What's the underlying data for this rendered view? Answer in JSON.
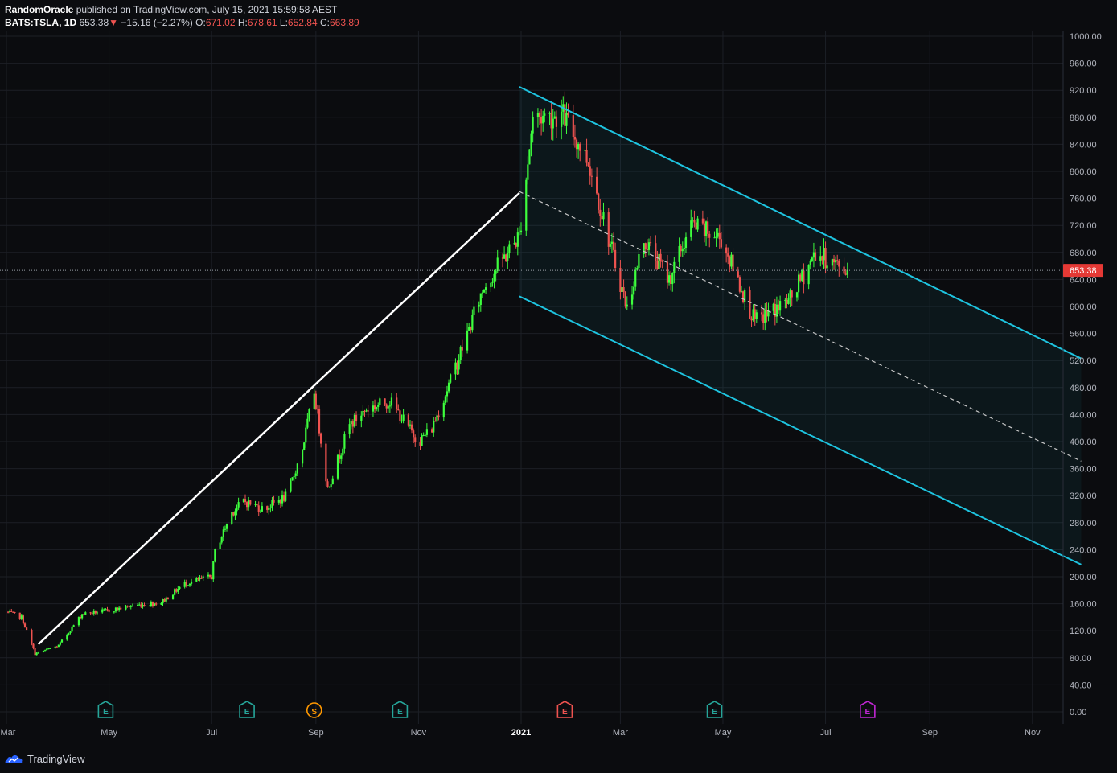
{
  "header": {
    "author": "RandomOracle",
    "published_text": "published on TradingView.com, July 15, 2021 15:59:58 AEST",
    "symbol": "BATS:TSLA, 1D",
    "last": "653.38",
    "change_arrow": "▼",
    "change": "−15.16 (−2.27%)",
    "o_label": "O:",
    "o_value": "671.02",
    "h_label": "H:",
    "h_value": "678.61",
    "l_label": "L:",
    "l_value": "652.84",
    "c_label": "C:",
    "c_value": "663.89"
  },
  "footer": {
    "brand": "TradingView"
  },
  "colors": {
    "background": "#0b0c0f",
    "up": "#3dff3d",
    "down": "#ef5350",
    "channel": "#1ec4e0",
    "trendline": "#ffffff",
    "grid": "#1c1f26",
    "price_label_bg": "#e53935",
    "earnings_green": "#26a69a",
    "earnings_red": "#ef5350",
    "split_orange": "#ff9800",
    "future_purple": "#c026d3"
  },
  "chart_data": {
    "type": "candlestick",
    "y_axis": {
      "min": 0,
      "max": 1000,
      "ticks": [
        "0.00",
        "40.00",
        "80.00",
        "120.00",
        "160.00",
        "200.00",
        "240.00",
        "280.00",
        "320.00",
        "360.00",
        "400.00",
        "440.00",
        "480.00",
        "520.00",
        "560.00",
        "600.00",
        "640.00",
        "680.00",
        "720.00",
        "760.00",
        "800.00",
        "840.00",
        "880.00",
        "920.00",
        "960.00",
        "1000.00"
      ]
    },
    "x_axis": {
      "labels": [
        "Mar",
        "May",
        "Jul",
        "Sep",
        "Nov",
        "2021",
        "Mar",
        "May",
        "Jul",
        "Sep",
        "Nov"
      ],
      "start": "2020-03-01",
      "end": "2021-11-30"
    },
    "grid": true,
    "last_price": "653.38",
    "price_path": [
      [
        "2020-03-01",
        148
      ],
      [
        "2020-03-10",
        140
      ],
      [
        "2020-03-18",
        86
      ],
      [
        "2020-04-01",
        98
      ],
      [
        "2020-04-15",
        145
      ],
      [
        "2020-05-01",
        150
      ],
      [
        "2020-05-15",
        157
      ],
      [
        "2020-06-01",
        162
      ],
      [
        "2020-06-15",
        190
      ],
      [
        "2020-07-01",
        200
      ],
      [
        "2020-07-03",
        238
      ],
      [
        "2020-07-13",
        295
      ],
      [
        "2020-07-20",
        312
      ],
      [
        "2020-08-01",
        300
      ],
      [
        "2020-08-15",
        320
      ],
      [
        "2020-08-24",
        390
      ],
      [
        "2020-08-31",
        475
      ],
      [
        "2020-09-08",
        330
      ],
      [
        "2020-09-21",
        424
      ],
      [
        "2020-10-01",
        448
      ],
      [
        "2020-10-15",
        460
      ],
      [
        "2020-11-01",
        400
      ],
      [
        "2020-11-09",
        420
      ],
      [
        "2020-11-20",
        490
      ],
      [
        "2020-12-10",
        630
      ],
      [
        "2020-12-31",
        705
      ],
      [
        "2021-01-08",
        880
      ],
      [
        "2021-01-26",
        883
      ],
      [
        "2021-02-10",
        815
      ],
      [
        "2021-03-05",
        597
      ],
      [
        "2021-03-15",
        700
      ],
      [
        "2021-03-30",
        640
      ],
      [
        "2021-04-12",
        720
      ],
      [
        "2021-04-30",
        700
      ],
      [
        "2021-05-20",
        577
      ],
      [
        "2021-06-10",
        610
      ],
      [
        "2021-06-25",
        680
      ],
      [
        "2021-07-08",
        660
      ],
      [
        "2021-07-14",
        653
      ]
    ],
    "events": [
      {
        "date": "2020-04-29",
        "kind": "E",
        "color": "earnings_green"
      },
      {
        "date": "2020-07-22",
        "kind": "E",
        "color": "earnings_green"
      },
      {
        "date": "2020-08-31",
        "kind": "S",
        "color": "split_orange"
      },
      {
        "date": "2020-10-21",
        "kind": "E",
        "color": "earnings_green"
      },
      {
        "date": "2021-01-27",
        "kind": "E",
        "color": "earnings_red"
      },
      {
        "date": "2021-04-26",
        "kind": "E",
        "color": "earnings_green"
      },
      {
        "date": "2021-07-26",
        "kind": "E",
        "color": "future_purple"
      }
    ],
    "drawings": {
      "trendline": [
        [
          "2020-03-20",
          100
        ],
        [
          "2020-12-31",
          768
        ]
      ],
      "channel_upper": [
        [
          "2020-12-31",
          925
        ],
        [
          "2021-11-30",
          523
        ]
      ],
      "channel_lower": [
        [
          "2020-12-31",
          615
        ],
        [
          "2021-11-30",
          218
        ]
      ],
      "channel_mid": [
        [
          "2020-12-31",
          770
        ],
        [
          "2021-11-30",
          371
        ]
      ]
    }
  }
}
